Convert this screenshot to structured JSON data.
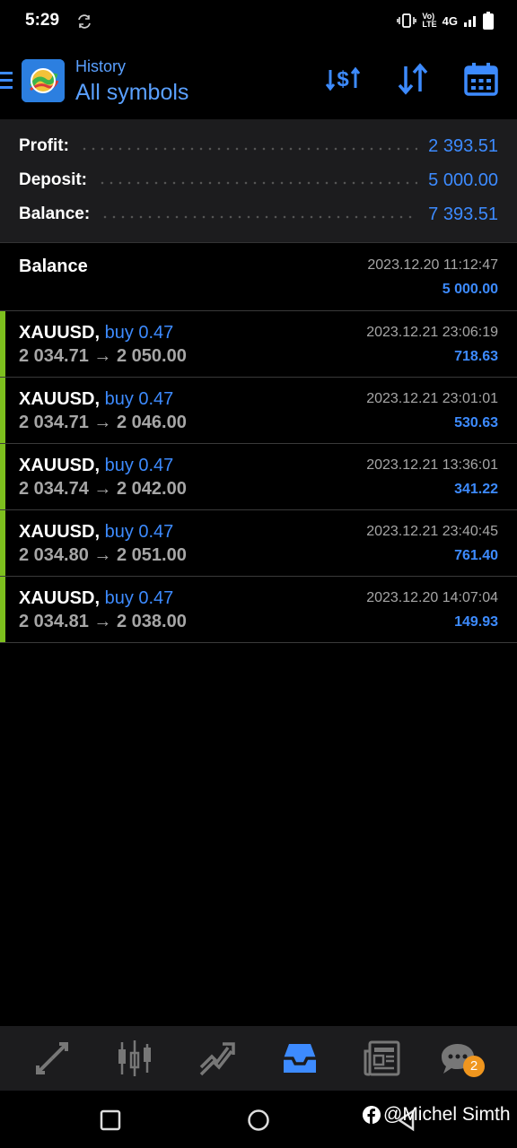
{
  "status": {
    "time": "5:29",
    "vol_line1": "Vo)",
    "vol_line2": "LTE",
    "network": "4G"
  },
  "header": {
    "subtitle": "History",
    "title": "All symbols",
    "buttons": [
      "dollar-sort-icon",
      "sort-icon",
      "calendar-icon"
    ]
  },
  "summary": {
    "profit_label": "Profit:",
    "profit_value": "2 393.51",
    "deposit_label": "Deposit:",
    "deposit_value": "5 000.00",
    "balance_label": "Balance:",
    "balance_value": "7 393.51"
  },
  "balance_entry": {
    "label": "Balance",
    "datetime": "2023.12.20 11:12:47",
    "amount": "5 000.00"
  },
  "deals": [
    {
      "symbol": "XAUUSD,",
      "side": "buy 0.47",
      "prices": "2 034.71 → 2 050.00",
      "datetime": "2023.12.21 23:06:19",
      "profit": "718.63"
    },
    {
      "symbol": "XAUUSD,",
      "side": "buy 0.47",
      "prices": "2 034.71 → 2 046.00",
      "datetime": "2023.12.21 23:01:01",
      "profit": "530.63"
    },
    {
      "symbol": "XAUUSD,",
      "side": "buy 0.47",
      "prices": "2 034.74 → 2 042.00",
      "datetime": "2023.12.21 13:36:01",
      "profit": "341.22"
    },
    {
      "symbol": "XAUUSD,",
      "side": "buy 0.47",
      "prices": "2 034.80 → 2 051.00",
      "datetime": "2023.12.21 23:40:45",
      "profit": "761.40"
    },
    {
      "symbol": "XAUUSD,",
      "side": "buy 0.47",
      "prices": "2 034.81 → 2 038.00",
      "datetime": "2023.12.20 14:07:04",
      "profit": "149.93"
    }
  ],
  "bottom_nav": {
    "items": [
      "quotes-icon",
      "chart-icon",
      "trade-icon",
      "history-icon",
      "news-icon",
      "chat-icon"
    ],
    "active": "history-icon",
    "chat_badge": "2"
  },
  "watermark": "@Michel Simth",
  "colors": {
    "accent_blue": "#3d8bff",
    "buy_green": "#7dbf1e",
    "badge_orange": "#f0961e"
  }
}
